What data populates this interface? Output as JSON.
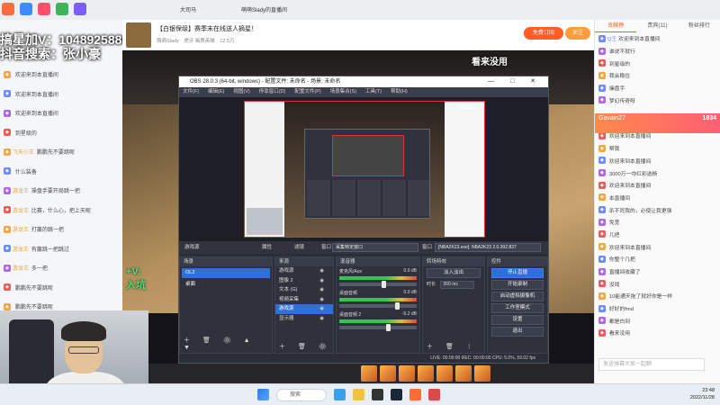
{
  "browser": {
    "tabs": [
      "大司马",
      "萌萌Slady的直播间"
    ]
  },
  "overlay": {
    "line1": "搞星加V：1048925880",
    "line2": "抖音搜索：张小豪",
    "side_tag_1": "+V:",
    "side_tag_2": "入坑"
  },
  "stream": {
    "title": "【白银保级】赛季末在线送人摘星！",
    "sub_name": "萌萌Slady",
    "sub_tag": "虎牙 画质英雄",
    "viewers": "12.5万",
    "subscribe_label": "免费订阅",
    "follow_label": "关注",
    "video_caption": "看来没用"
  },
  "left_chat": [
    {
      "user": "",
      "text": "欢迎来到本直播间"
    },
    {
      "user": "",
      "text": "欢迎来到本直播间"
    },
    {
      "user": "",
      "text": "欢迎来到本直播间"
    },
    {
      "user": "",
      "text": "到星级的"
    },
    {
      "user": "飞天小王",
      "text": "鹏鹏先不要跳呢"
    },
    {
      "user": "",
      "text": "什么装备"
    },
    {
      "user": "游龙王",
      "text": "操盘手要开局跳一把"
    },
    {
      "user": "游龙王",
      "text": "比赛，什么心，把上天呢"
    },
    {
      "user": "游龙王",
      "text": "打赢的跳一把"
    },
    {
      "user": "游龙王",
      "text": "有赢跳一把跳过"
    },
    {
      "user": "游龙王",
      "text": "多一把"
    },
    {
      "user": "",
      "text": "鹏鹏先不要跳呢"
    },
    {
      "user": "",
      "text": "鹏鹏先不要跳呢"
    },
    {
      "user": "",
      "text": "鹏鹏先不要跳呢"
    },
    {
      "user": "",
      "text": "鹏鹏先不要跳呢"
    }
  ],
  "right_panel": {
    "tabs": [
      "贡献榜",
      "贵宾(11)",
      "粉丝排行"
    ],
    "gift_banner": "Gavain27",
    "gift_count": "1834",
    "messages": [
      {
        "user": "Q王",
        "text": "欢迎来到本直播间"
      },
      {
        "user": "",
        "text": "谁说不就行"
      },
      {
        "user": "",
        "text": "到星级的"
      },
      {
        "user": "",
        "text": "我会稳住"
      },
      {
        "user": "",
        "text": "操盘手"
      },
      {
        "user": "",
        "text": "梦幻传奇呀"
      },
      {
        "user": "",
        "text": "欢迎来到本直播间"
      },
      {
        "user": "",
        "text": "帮我"
      },
      {
        "user": "",
        "text": "欢迎来到本直播间"
      },
      {
        "user": "",
        "text": "3000万一夺红彩选杨"
      },
      {
        "user": "",
        "text": "欢迎来到本直播间"
      },
      {
        "user": "",
        "text": "本直播间"
      },
      {
        "user": "",
        "text": "杀不死我的，必使让我更强"
      },
      {
        "user": "",
        "text": "免宽"
      },
      {
        "user": "",
        "text": "几把"
      },
      {
        "user": "",
        "text": "欢迎来到本直播间"
      },
      {
        "user": "",
        "text": "你整个几把"
      },
      {
        "user": "",
        "text": "直播间收藏了"
      },
      {
        "user": "",
        "text": "没戏"
      },
      {
        "user": "",
        "text": "10能通天拖了就好你是一样"
      },
      {
        "user": "",
        "text": "好好的fmd"
      },
      {
        "user": "",
        "text": "都是白到"
      },
      {
        "user": "",
        "text": "看来没用"
      }
    ],
    "input_placeholder": "发送弹幕大家一起聊"
  },
  "obs": {
    "window_title": "OBS 28.0.3 (64-bit, windows) - 配置文件: 未命名 - 场景: 未命名",
    "window_controls": "— □ ✕",
    "menu": [
      "文件(F)",
      "编辑(E)",
      "视图(V)",
      "停靠窗口(D)",
      "配置文件(P)",
      "场景集合(S)",
      "工具(T)",
      "帮助(H)"
    ],
    "source_bar": {
      "source_name": "游戏源",
      "properties_label": "属性",
      "filters_label": "滤镜",
      "window_label": "窗口",
      "window_value": "采集特定窗口",
      "window2_label": "窗口",
      "window2_value": "[NBA2K23.exe]: NBA2K23 2.0.392.837"
    },
    "docks": {
      "scenes_title": "场景",
      "scenes": [
        "OL2",
        "桌面"
      ],
      "sources_title": "来源",
      "sources": [
        "游戏源",
        "图像 2",
        "文本 (G)",
        "视频采集",
        "游戏源",
        "显示器"
      ],
      "mixer_title": "混音器",
      "mixer": [
        {
          "name": "麦克风/Aux",
          "db": "0.0 dB",
          "level": 0.55
        },
        {
          "name": "桌面音频",
          "db": "0.0 dB",
          "level": 0.72
        },
        {
          "name": "桌面音频 2",
          "db": "-5.2 dB",
          "level": 0.6
        }
      ],
      "transitions_title": "转场特效",
      "transition_value": "淡入淡出",
      "duration_label": "时长",
      "duration_value": "300 ms",
      "controls_title": "控件",
      "controls": [
        "停止直播",
        "开始录制",
        "启动虚拟摄像机",
        "工作室模式",
        "设置",
        "退出"
      ]
    },
    "status": "LIVE: 00:00:00  REC: 00:00:00  CPU: 5.0%, 59.02 fps"
  },
  "taskbar": {
    "search_label": "搜索",
    "time": "23:48",
    "date": "2022/11/28"
  },
  "colors": {
    "accent": "#ff5d23",
    "obs_selected": "#2f6fd6",
    "preview_border": "#e0303a"
  }
}
